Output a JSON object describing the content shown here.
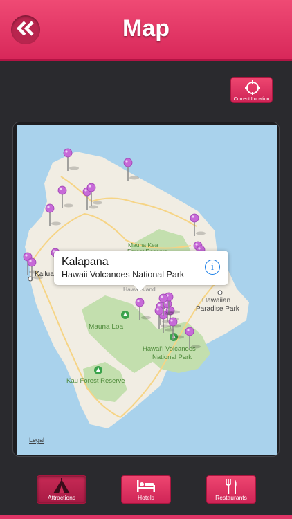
{
  "header": {
    "title": "Map"
  },
  "current_location": {
    "label": "Current Location"
  },
  "map": {
    "labels": {
      "mauna_kea": "Mauna Kea",
      "forest_reserve": "Forest Reserve",
      "kailua": "Kailua",
      "hawaii_island": "Hawa Island",
      "hawaiian": "Hawaiian",
      "paradise_park": "Paradise Park",
      "mauna_loa": "Mauna Loa",
      "volcanoes": "Hawai'i Volcanoes",
      "national_park": "National Park",
      "kau_forest": "Kau Forest Reserve",
      "legal": "Legal"
    },
    "callout": {
      "title": "Kalapana",
      "subtitle": "Hawaii Volcanoes National Park",
      "info_glyph": "i"
    }
  },
  "tabs": [
    {
      "label": "Attractions",
      "icon": "tent-icon",
      "active": true
    },
    {
      "label": "Hotels",
      "icon": "bed-icon",
      "active": false
    },
    {
      "label": "Restaurants",
      "icon": "fork-knife-icon",
      "active": false
    }
  ],
  "colors": {
    "accent": "#e03566",
    "water": "#a9d2ec",
    "land": "#f1ede3",
    "park": "#c3dfae",
    "pin": "#c76ad8"
  }
}
